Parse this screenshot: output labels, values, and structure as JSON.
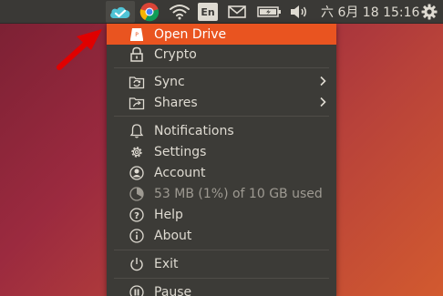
{
  "panel": {
    "language_label": "En",
    "clock": "六 6月 18 15:16",
    "icons": [
      "cloud-sync-icon",
      "chrome-icon",
      "wifi-icon",
      "keyboard-layout-icon",
      "mail-icon",
      "battery-icon",
      "volume-icon",
      "system-gear-icon"
    ]
  },
  "menu": {
    "open_drive": "Open Drive",
    "crypto": "Crypto",
    "sync": "Sync",
    "shares": "Shares",
    "notifications": "Notifications",
    "settings": "Settings",
    "account": "Account",
    "usage": "53 MB (1%) of 10 GB used",
    "help": "Help",
    "about": "About",
    "exit": "Exit",
    "pause": "Pause"
  },
  "colors": {
    "panel_bg": "#3a3936",
    "menu_bg": "#3c3b37",
    "menu_text": "#dfdbd2",
    "highlight": "#e95420",
    "accent_cyan": "#4fc3d6",
    "annotation_red": "#e00000"
  }
}
